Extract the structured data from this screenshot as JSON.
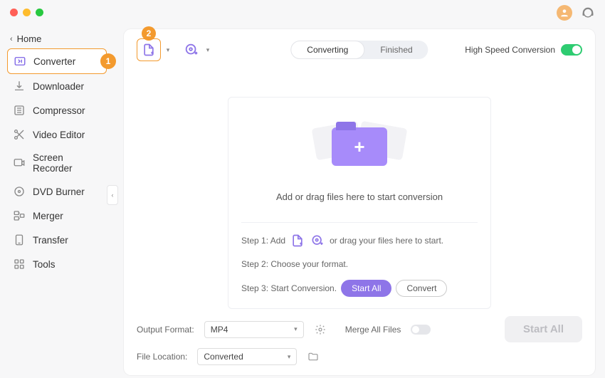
{
  "titlebar": {
    "avatar_initial": ""
  },
  "sidebar": {
    "home": "Home",
    "items": [
      {
        "label": "Converter",
        "badge": "1",
        "active": true,
        "icon": "converter"
      },
      {
        "label": "Downloader",
        "icon": "downloader"
      },
      {
        "label": "Compressor",
        "icon": "compressor"
      },
      {
        "label": "Video Editor",
        "icon": "editor"
      },
      {
        "label": "Screen Recorder",
        "icon": "recorder"
      },
      {
        "label": "DVD Burner",
        "icon": "dvd"
      },
      {
        "label": "Merger",
        "icon": "merger"
      },
      {
        "label": "Transfer",
        "icon": "transfer"
      },
      {
        "label": "Tools",
        "icon": "tools"
      }
    ]
  },
  "toolbar": {
    "add_file_badge": "2",
    "tabs": {
      "converting": "Converting",
      "finished": "Finished"
    },
    "hsc_label": "High Speed Conversion"
  },
  "drop": {
    "main_text": "Add or drag files here to start conversion",
    "step1_prefix": "Step 1: Add",
    "step1_suffix": "or drag your files here to start.",
    "step2": "Step 2: Choose your format.",
    "step3_prefix": "Step 3: Start Conversion.",
    "start_all": "Start  All",
    "convert": "Convert"
  },
  "bottom": {
    "output_format_label": "Output Format:",
    "output_format_value": "MP4",
    "file_location_label": "File Location:",
    "file_location_value": "Converted",
    "merge_label": "Merge All Files",
    "start_all_big": "Start All"
  }
}
